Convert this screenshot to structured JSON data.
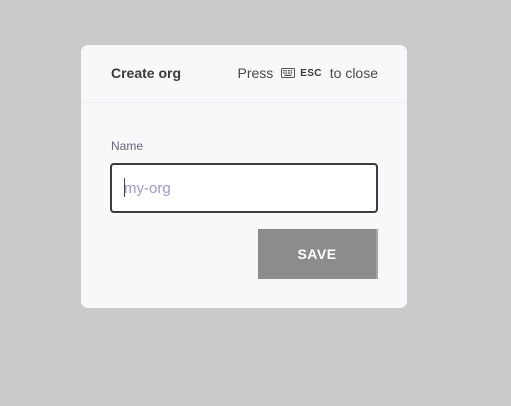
{
  "modal": {
    "title": "Create org",
    "close_hint": {
      "prefix": "Press",
      "key": "ESC",
      "suffix": "to close",
      "icon": "keyboard-icon"
    }
  },
  "form": {
    "name_label": "Name",
    "name_placeholder": "my-org",
    "name_value": "",
    "save_label": "SAVE"
  },
  "colors": {
    "backdrop": "#cacaca",
    "modal_bg": "#f7f8fa",
    "button_bg": "#8c8c8c",
    "placeholder": "#a497c4",
    "label": "#6b6580"
  }
}
